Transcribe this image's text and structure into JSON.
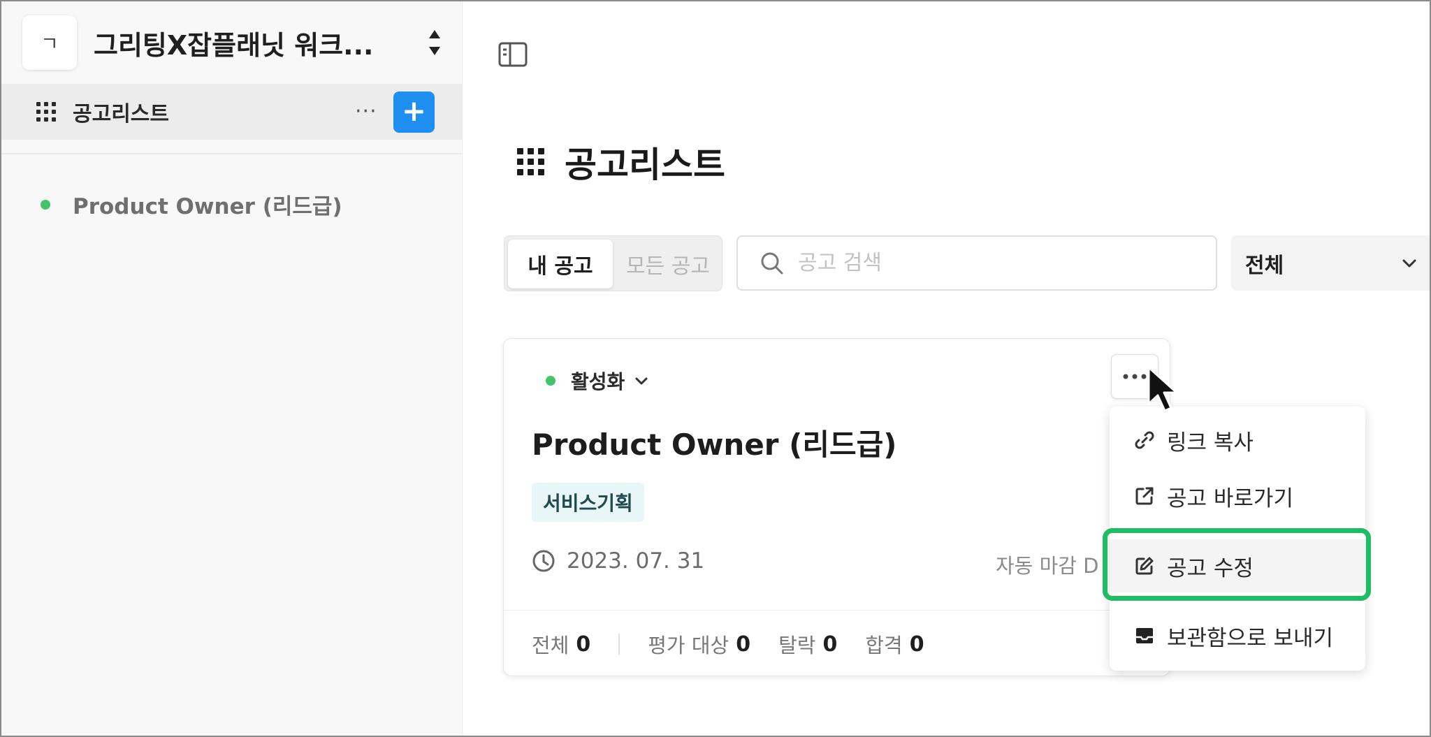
{
  "sidebar": {
    "workspace_avatar": "ㄱ",
    "workspace_title": "그리팅X잡플래닛 워크...",
    "nav_active_label": "공고리스트",
    "nav_more": "···",
    "nav_add": "+",
    "items": [
      {
        "label": "Product Owner (리드급)",
        "status_color": "#43c46b"
      }
    ]
  },
  "main": {
    "page_title": "공고리스트",
    "segment": {
      "mine": "내 공고",
      "all": "모든 공고"
    },
    "search": {
      "placeholder": "공고 검색",
      "value": ""
    },
    "filter": {
      "selected": "전체"
    },
    "card": {
      "status": "활성화",
      "title": "Product Owner (리드급)",
      "tag": "서비스기획",
      "date": "2023. 07. 31",
      "auto_close": "자동 마감 D",
      "stats": [
        {
          "label": "전체",
          "value": "0"
        },
        {
          "label": "평가 대상",
          "value": "0"
        },
        {
          "label": "탈락",
          "value": "0"
        },
        {
          "label": "합격",
          "value": "0"
        }
      ]
    },
    "menu": {
      "copy_link": "링크 복사",
      "go_to_posting": "공고 바로가기",
      "edit_posting": "공고 수정",
      "archive": "보관함으로 보내기"
    }
  },
  "colors": {
    "accent_blue": "#1f8ef1",
    "active_green": "#43c46b",
    "highlight_green": "#1fbd63"
  }
}
